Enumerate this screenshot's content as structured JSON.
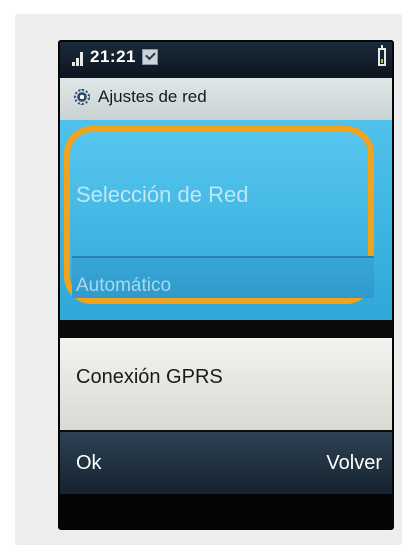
{
  "status_bar": {
    "time": "21:21",
    "icons": [
      "signal-icon",
      "message-icon",
      "battery-icon"
    ]
  },
  "title_bar": {
    "icon": "gear-icon",
    "title": "Ajustes de red"
  },
  "menu": {
    "selected_item": {
      "label": "Selección de Red",
      "value": "Automático"
    },
    "items": [
      {
        "label": "Conexión GPRS"
      }
    ]
  },
  "softkeys": {
    "left": "Ok",
    "right": "Volver"
  },
  "colors": {
    "highlight_ring": "#f2a21b",
    "selected_bg": "#3fb4e2",
    "softkey_bg": "#1e3040"
  }
}
